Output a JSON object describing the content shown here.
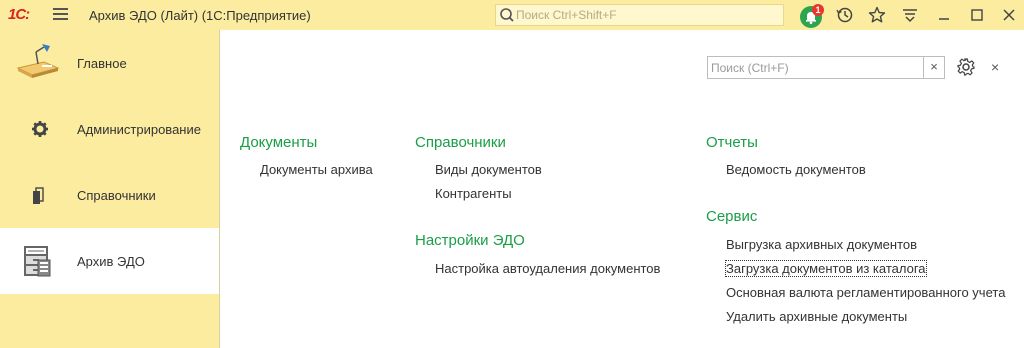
{
  "titlebar": {
    "logo": "1С:",
    "app_title": "Архив ЭДО (Лайт)  (1С:Предприятие)",
    "search_placeholder": "Поиск Ctrl+Shift+F",
    "notification_count": "1"
  },
  "sidebar": {
    "items": [
      {
        "label": "Главное",
        "icon": "main-desk-icon",
        "active": false
      },
      {
        "label": "Администрирование",
        "icon": "gear-icon",
        "active": false
      },
      {
        "label": "Справочники",
        "icon": "books-icon",
        "active": false
      },
      {
        "label": "Архив ЭДО",
        "icon": "archive-cabinet-icon",
        "active": true
      }
    ]
  },
  "main": {
    "search_placeholder": "Поиск (Ctrl+F)",
    "search_clear": "×",
    "close_label": "×",
    "columns": [
      {
        "sections": [
          {
            "title": "Документы",
            "links": [
              "Документы архива"
            ]
          }
        ]
      },
      {
        "sections": [
          {
            "title": "Справочники",
            "links": [
              "Виды документов",
              "Контрагенты"
            ]
          },
          {
            "title": "Настройки ЭДО",
            "links": [
              "Настройка автоудаления документов"
            ]
          }
        ]
      },
      {
        "sections": [
          {
            "title": "Отчеты",
            "links": [
              "Ведомость документов"
            ]
          },
          {
            "title": "Сервис",
            "links": [
              "Выгрузка архивных документов",
              "Загрузка документов из каталога",
              "Основная валюта регламентированного учета",
              "Удалить архивные документы"
            ]
          }
        ]
      }
    ]
  },
  "colors": {
    "accent_green": "#1a9e47",
    "panel_yellow": "#fbeca0",
    "brand_red": "#d9251d",
    "notification_green": "#2da44e",
    "badge_red": "#e8362a"
  }
}
